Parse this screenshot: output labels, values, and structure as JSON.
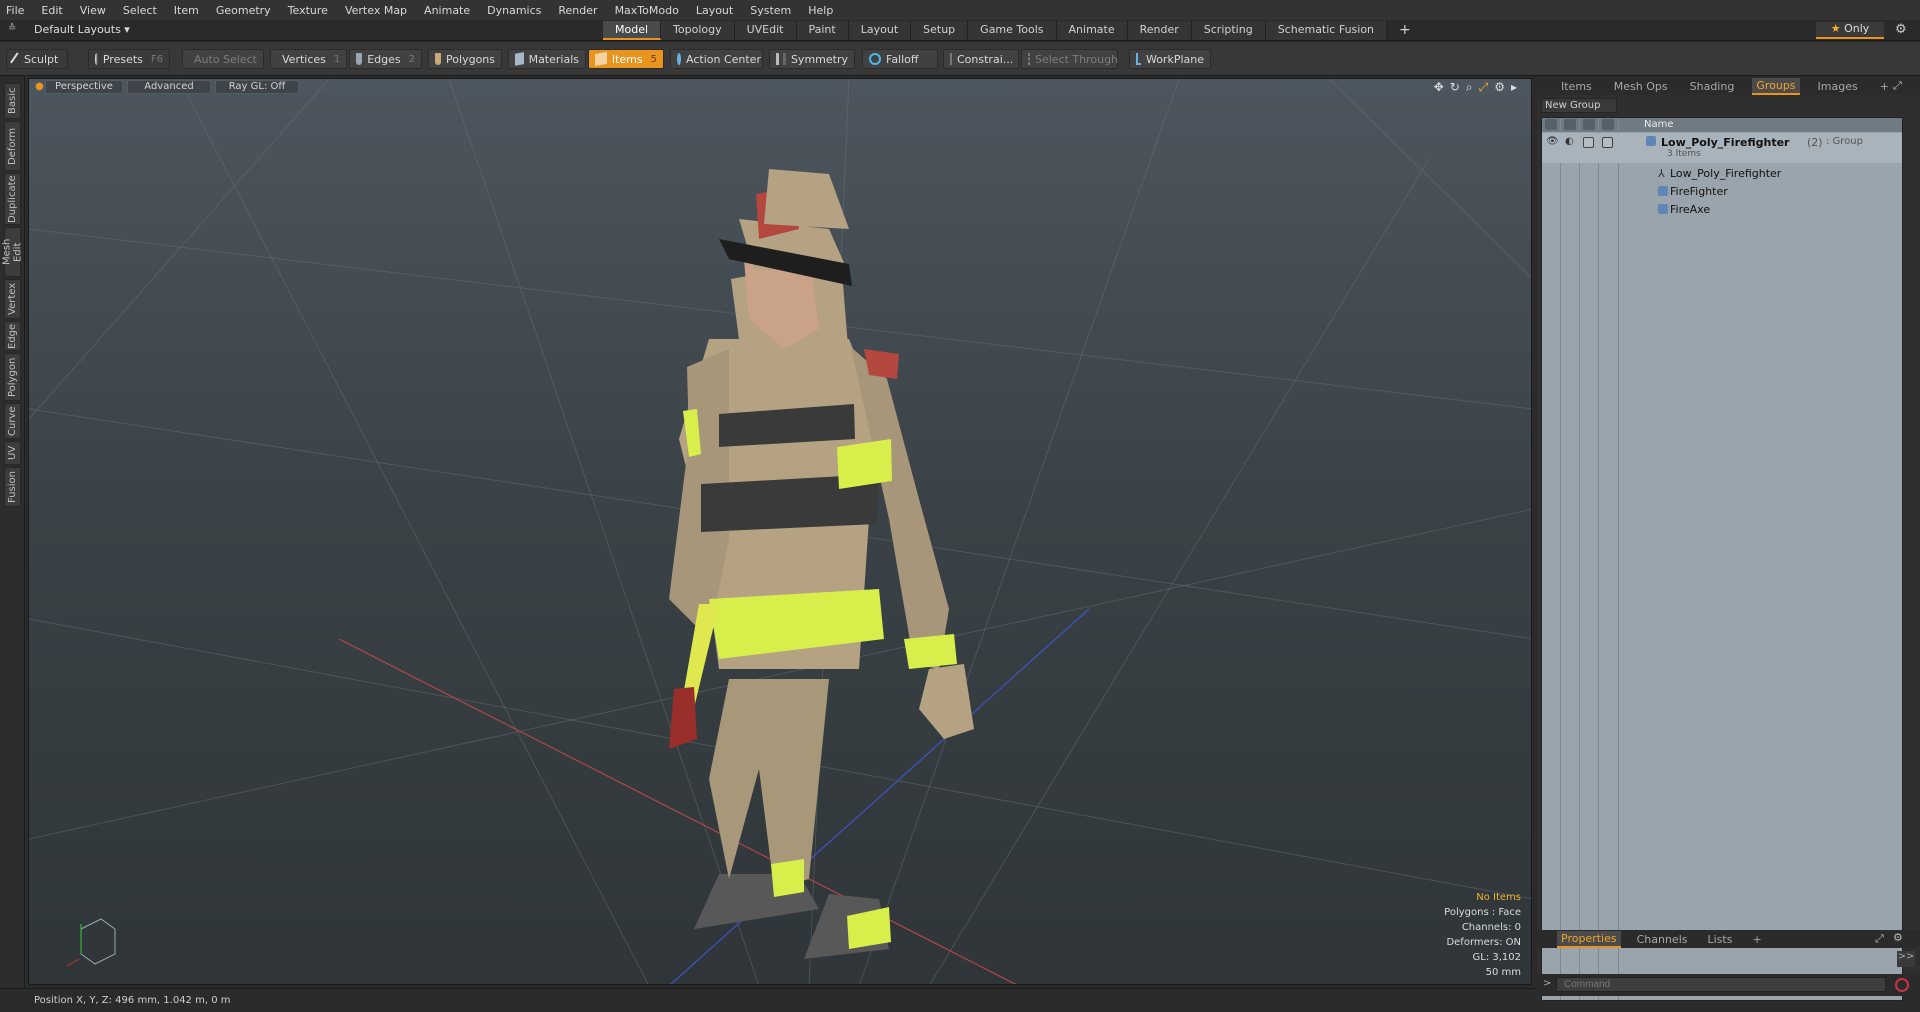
{
  "menu": [
    "File",
    "Edit",
    "View",
    "Select",
    "Item",
    "Geometry",
    "Texture",
    "Vertex Map",
    "Animate",
    "Dynamics",
    "Render",
    "MaxToModo",
    "Layout",
    "System",
    "Help"
  ],
  "layout_dropdown": "Default Layouts ▾",
  "tabs": [
    "Model",
    "Topology",
    "UVEdit",
    "Paint",
    "Layout",
    "Setup",
    "Game Tools",
    "Animate",
    "Render",
    "Scripting",
    "Schematic Fusion",
    "+"
  ],
  "active_tab": "Model",
  "only_label": "Only",
  "toolbar": {
    "sculpt": "Sculpt",
    "presets": "Presets",
    "presets_key": "F6",
    "auto_select": "Auto Select",
    "vertices": "Vertices",
    "vertices_key": "1",
    "edges": "Edges",
    "edges_key": "2",
    "polygons": "Polygons",
    "materials": "Materials",
    "items": "Items",
    "items_key": "5",
    "action_center": "Action Center",
    "symmetry": "Symmetry",
    "falloff": "Falloff",
    "constraints": "Constrai...",
    "select_through": "Select Through",
    "workplane": "WorkPlane"
  },
  "left_tabs": [
    "Basic",
    "Deform",
    "Duplicate",
    "Mesh Edit",
    "Vertex",
    "Edge",
    "Polygon",
    "Curve",
    "UV",
    "Fusion"
  ],
  "viewport": {
    "perspective": "Perspective",
    "advanced": "Advanced",
    "raygl": "Ray GL: Off",
    "info": {
      "no_items": "No Items",
      "polygons": "Polygons : Face",
      "channels": "Channels: 0",
      "deformers": "Deformers: ON",
      "gl": "GL: 3,102",
      "size": "50 mm"
    }
  },
  "status": "Position X, Y, Z:  496 mm, 1.042 m, 0 m",
  "right_panel": {
    "tabs": [
      "Items",
      "Mesh Ops",
      "Shading",
      "Groups",
      "Images",
      "+"
    ],
    "active_tab": "Groups",
    "new_group": "New Group",
    "name_header": "Name",
    "group_name": "Low_Poly_Firefighter",
    "group_count": "(2)",
    "group_type": ": Group",
    "group_items": "3 Items",
    "children": [
      "Low_Poly_Firefighter",
      "FireFighter",
      "FireAxe"
    ],
    "bottom_tabs": [
      "Properties",
      "Channels",
      "Lists",
      "+"
    ],
    "bottom_active": "Properties",
    "command_placeholder": "Command"
  }
}
